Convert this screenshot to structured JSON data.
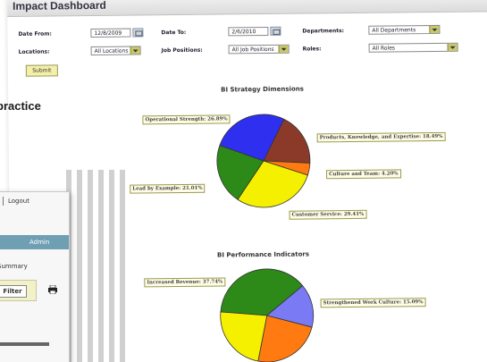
{
  "window": {
    "title": "Impact Dashboard"
  },
  "filters": {
    "date_from": {
      "label": "Date From:",
      "value": "12/8/2009"
    },
    "date_to": {
      "label": "Date To:",
      "value": "2/6/2010"
    },
    "departments": {
      "label": "Departments:",
      "value": "All Departments"
    },
    "locations": {
      "label": "Locations:",
      "value": "All Locations"
    },
    "job_positions": {
      "label": "Job Positions:",
      "value": "All Job Positions"
    },
    "roles": {
      "label": "Roles:",
      "value": "All Roles"
    },
    "submit_label": "Submit"
  },
  "overlay": {
    "practice_text": "practice",
    "logout": "Logout",
    "admin": "Admin",
    "summary": "Summary",
    "filter_button": "Filter"
  },
  "chart_data": [
    {
      "type": "pie",
      "title": "BI Strategy Dimensions",
      "slices": [
        {
          "label": "Operational Strength: 26.89%",
          "value": 26.89,
          "color": "#2f2ff0"
        },
        {
          "label": "Products, Knowledge, and Expertise: 18.49%",
          "value": 18.49,
          "color": "#8b3a2a"
        },
        {
          "label": "Culture and Team: 4.20%",
          "value": 4.2,
          "color": "#ff7a10"
        },
        {
          "label": "Customer Service: 29.41%",
          "value": 29.41,
          "color": "#f5f000"
        },
        {
          "label": "Lead by Example: 21.01%",
          "value": 21.01,
          "color": "#2d8a18"
        }
      ]
    },
    {
      "type": "pie",
      "title": "BI Performance Indicators",
      "slices": [
        {
          "label": "Increased Revenue: 37.74%",
          "value": 37.74,
          "color": "#2d8a18"
        },
        {
          "label": "Strengthened Work Culture: 15.09%",
          "value": 15.09,
          "color": "#7a7af5"
        },
        {
          "label": "",
          "value": 24.0,
          "color": "#ff7a10"
        },
        {
          "label": "",
          "value": 23.17,
          "color": "#f5f000"
        }
      ]
    }
  ]
}
